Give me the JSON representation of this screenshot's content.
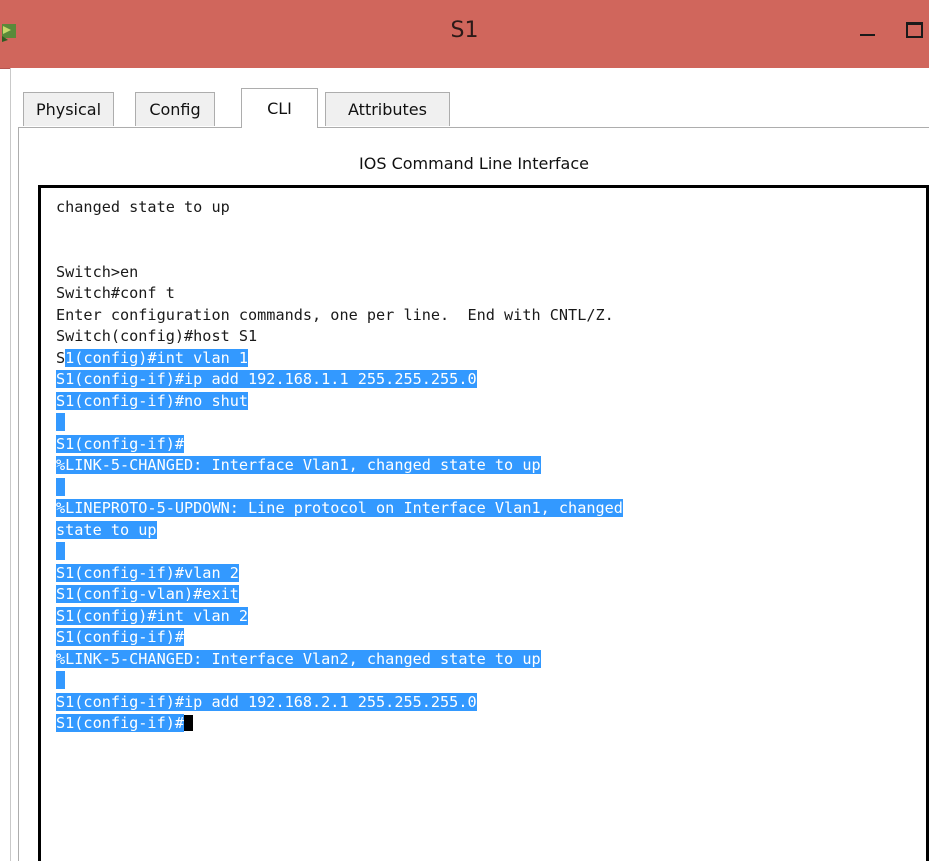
{
  "window": {
    "title": "S1",
    "icon": "packet-tracer-switch-icon"
  },
  "tabs": [
    {
      "label": "Physical",
      "active": false
    },
    {
      "label": "Config",
      "active": false
    },
    {
      "label": "CLI",
      "active": true
    },
    {
      "label": "Attributes",
      "active": false
    }
  ],
  "panel": {
    "title": "IOS Command Line Interface"
  },
  "colors": {
    "titlebar": "#d0665c",
    "selection": "#3399ff"
  },
  "cli": {
    "lines": [
      {
        "pre": "changed state to up",
        "sel": ""
      },
      {
        "pre": "",
        "sel": ""
      },
      {
        "pre": "",
        "sel": ""
      },
      {
        "pre": "Switch>en",
        "sel": ""
      },
      {
        "pre": "Switch#conf t",
        "sel": ""
      },
      {
        "pre": "Enter configuration commands, one per line.  End with CNTL/Z.",
        "sel": ""
      },
      {
        "pre": "Switch(config)#host S1",
        "sel": ""
      },
      {
        "pre": "S",
        "sel": "1(config)#int vlan 1"
      },
      {
        "pre": "",
        "sel": "S1(config-if)#ip add 192.168.1.1 255.255.255.0"
      },
      {
        "pre": "",
        "sel": "S1(config-if)#no shut"
      },
      {
        "pre": "",
        "sel": " "
      },
      {
        "pre": "",
        "sel": "S1(config-if)#"
      },
      {
        "pre": "",
        "sel": "%LINK-5-CHANGED: Interface Vlan1, changed state to up"
      },
      {
        "pre": "",
        "sel": " "
      },
      {
        "pre": "",
        "sel": "%LINEPROTO-5-UPDOWN: Line protocol on Interface Vlan1, changed"
      },
      {
        "pre": "",
        "sel": "state to up"
      },
      {
        "pre": "",
        "sel": " "
      },
      {
        "pre": "",
        "sel": "S1(config-if)#vlan 2"
      },
      {
        "pre": "",
        "sel": "S1(config-vlan)#exit"
      },
      {
        "pre": "",
        "sel": "S1(config)#int vlan 2"
      },
      {
        "pre": "",
        "sel": "S1(config-if)#"
      },
      {
        "pre": "",
        "sel": "%LINK-5-CHANGED: Interface Vlan2, changed state to up"
      },
      {
        "pre": "",
        "sel": " "
      },
      {
        "pre": "",
        "sel": "S1(config-if)#ip add 192.168.2.1 255.255.255.0"
      },
      {
        "pre": "",
        "sel": "S1(config-if)#",
        "cursor": true
      }
    ]
  }
}
